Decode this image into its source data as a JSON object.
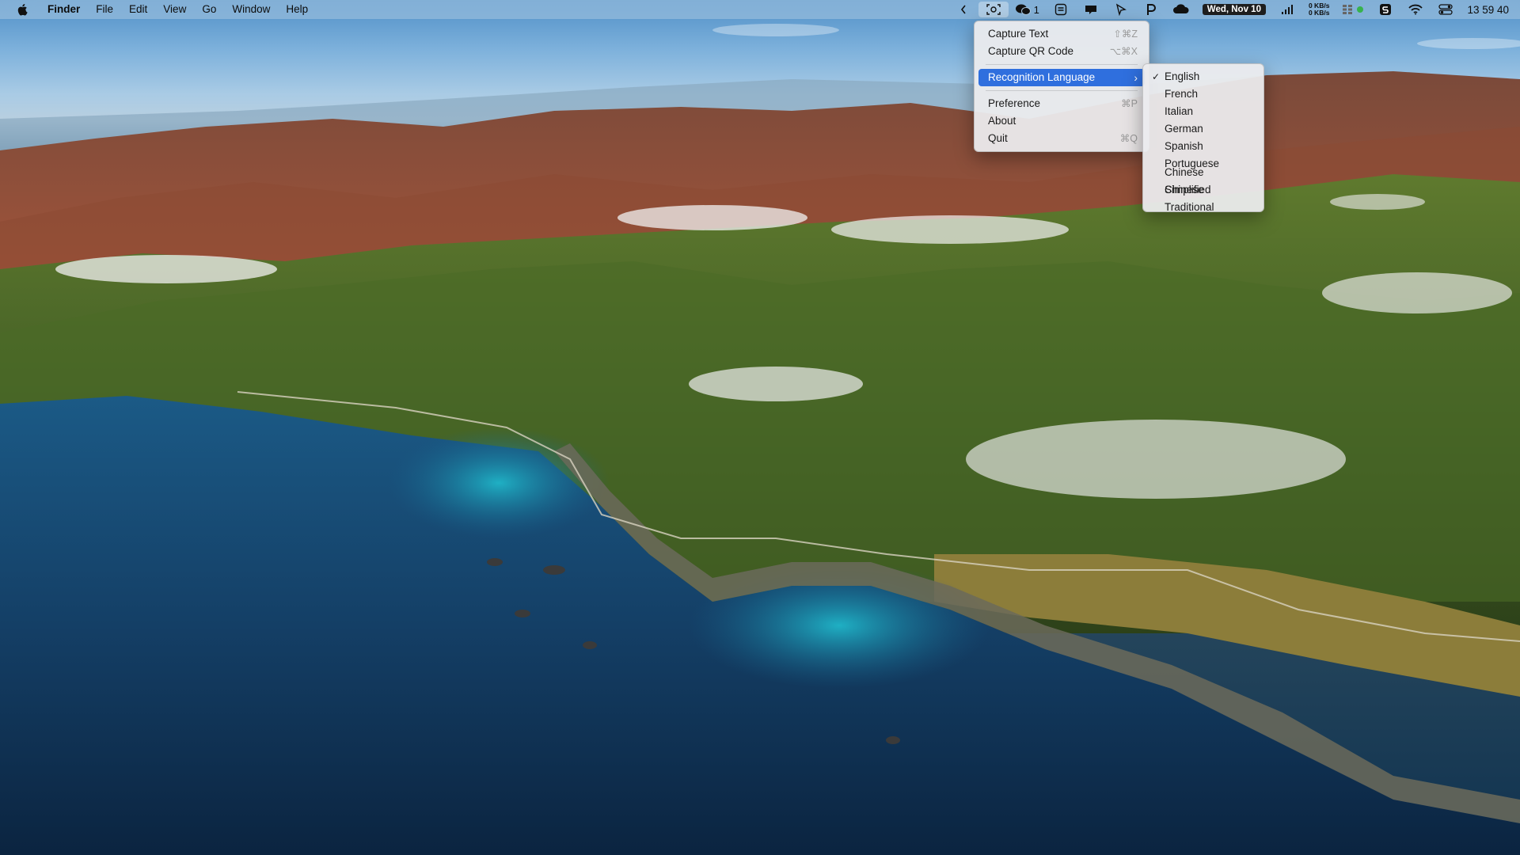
{
  "menubar": {
    "app_name": "Finder",
    "menus": [
      "File",
      "Edit",
      "View",
      "Go",
      "Window",
      "Help"
    ],
    "wechat_badge": "1",
    "date": "Wed, Nov 10",
    "net_up": "0 KB/s",
    "net_down": "0 KB/s",
    "time": "13 59 40"
  },
  "main_menu": {
    "capture_text": {
      "label": "Capture Text",
      "shortcut": "⇧⌘Z"
    },
    "capture_qr": {
      "label": "Capture QR Code",
      "shortcut": "⌥⌘X"
    },
    "recognition_language": {
      "label": "Recognition Language",
      "arrow": "›"
    },
    "preference": {
      "label": "Preference",
      "shortcut": "⌘P"
    },
    "about": {
      "label": "About"
    },
    "quit": {
      "label": "Quit",
      "shortcut": "⌘Q"
    }
  },
  "language_menu": {
    "selected": "English",
    "check_glyph": "✓",
    "items": [
      "English",
      "French",
      "Italian",
      "German",
      "Spanish",
      "Portuguese",
      "Chinese Simplified",
      "Chinese Traditional"
    ]
  },
  "colors": {
    "highlight": "#2f6fde",
    "date_badge_bg": "#1e1e1e"
  },
  "icons": [
    "apple-logo-icon",
    "chevron-left-icon",
    "screen-capture-icon",
    "wechat-icon",
    "scanner-icon",
    "notification-icon",
    "cursor-icon",
    "p-app-icon",
    "cloud-icon",
    "signal-bars-icon",
    "cpu-grid-icon",
    "status-dot-icon",
    "s-app-icon",
    "wifi-icon",
    "control-center-icon"
  ]
}
